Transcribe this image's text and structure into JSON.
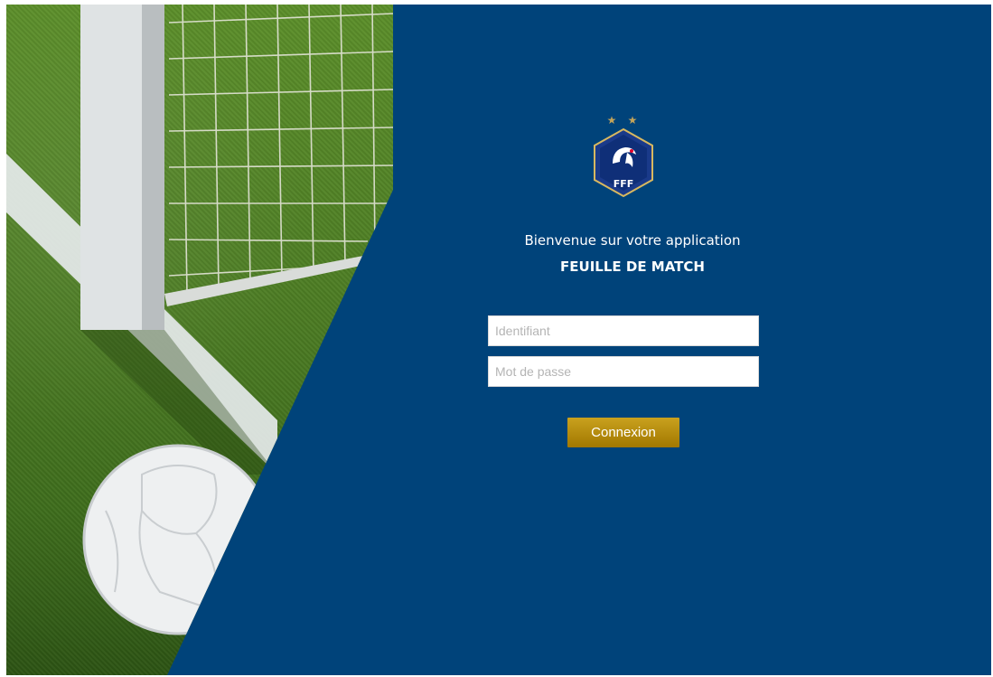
{
  "brand": {
    "logo_text": "FFF",
    "stars": "★ ★"
  },
  "welcome": {
    "line1": "Bienvenue sur votre application",
    "line2": "FEUILLE DE MATCH"
  },
  "login": {
    "username_placeholder": "Identifiant",
    "password_placeholder": "Mot de passe",
    "submit_label": "Connexion"
  },
  "colors": {
    "background": "#00437a",
    "button": "#b38a10",
    "logo_gold": "#c3a45a"
  },
  "icons": [
    "fff-crest-icon",
    "rooster-icon",
    "star-icon"
  ]
}
